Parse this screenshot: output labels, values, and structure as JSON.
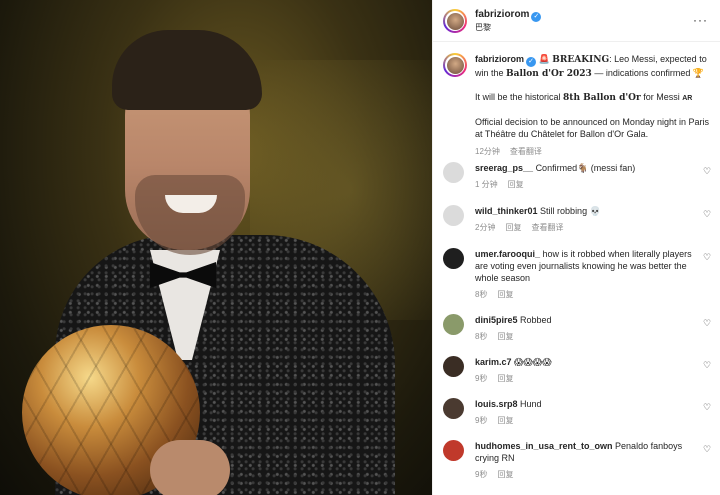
{
  "post": {
    "username": "fabriziorom",
    "location": "巴黎",
    "more": "···"
  },
  "caption": {
    "username": "fabriziorom",
    "siren": "🚨",
    "breaking": "BREAKING",
    "line1_a": ": Leo Messi, expected to win the ",
    "ballon": "Ballon d'Or 2023",
    "line1_b": " — indications confirmed ",
    "trophy": "🏆",
    "p2_a": "It will be the historical ",
    "p2_b": "8th Ballon d'Or",
    "p2_c": " for Messi ",
    "ar": "AR",
    "p3": "Official decision to be announced on Monday night in Paris at Théâtre du Châtelet for Ballon d'Or Gala.",
    "time": "12分钟",
    "translate": "查看翻译"
  },
  "comments": [
    {
      "user": "sreerag_ps__",
      "text": "Confirmed🐐 (messi fan)",
      "time": "1 分钟",
      "actions": [
        "回复"
      ],
      "avatar_color": "#dbdbdb"
    },
    {
      "user": "wild_thinker01",
      "text": "Still robbing 💀",
      "time": "2分钟",
      "actions": [
        "回复",
        "查看翻译"
      ],
      "avatar_color": "#dbdbdb"
    },
    {
      "user": "umer.farooqui_",
      "text": "how is it robbed when literally players are voting even journalists knowing he was better the whole season",
      "time": "8秒",
      "actions": [
        "回复"
      ],
      "avatar_color": "#1f1f1f"
    },
    {
      "user": "dini5pire5",
      "text": "Robbed",
      "time": "8秒",
      "actions": [
        "回复"
      ],
      "avatar_color": "#8a9a6a"
    },
    {
      "user": "karim.c7",
      "text": "😱😱😱😱",
      "time": "9秒",
      "actions": [
        "回复"
      ],
      "avatar_color": "#3a2d24"
    },
    {
      "user": "louis.srp8",
      "text": "Hund",
      "time": "9秒",
      "actions": [
        "回复"
      ],
      "avatar_color": "#4a3a30"
    },
    {
      "user": "hudhomes_in_usa_rent_to_own",
      "text": "Penaldo fanboys crying RN",
      "time": "9秒",
      "actions": [
        "回复"
      ],
      "avatar_color": "#c0392b"
    }
  ]
}
